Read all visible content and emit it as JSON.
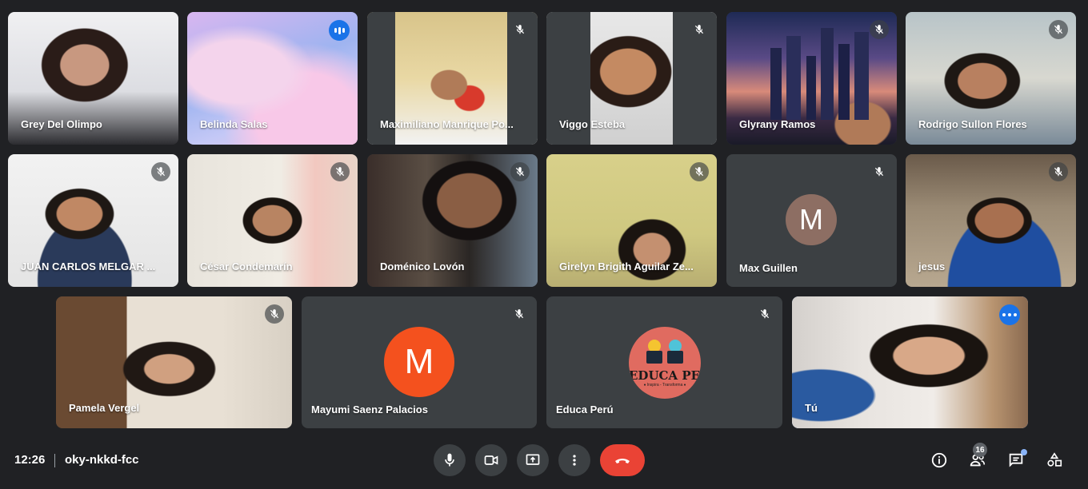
{
  "participants": [
    {
      "name": "Grey Del Olimpo",
      "mic": "none"
    },
    {
      "name": "Belinda Salas",
      "mic": "speaking"
    },
    {
      "name": "Maximiliano Manrique Po...",
      "mic": "muted"
    },
    {
      "name": "Viggo Esteba",
      "mic": "muted"
    },
    {
      "name": "Glyrany Ramos",
      "mic": "muted"
    },
    {
      "name": "Rodrigo Sullon Flores",
      "mic": "muted"
    },
    {
      "name": "JUAN CARLOS MELGAR ...",
      "mic": "muted"
    },
    {
      "name": "César Condemarín",
      "mic": "muted"
    },
    {
      "name": "Doménico Lovón",
      "mic": "muted"
    },
    {
      "name": "Girelyn Brigith Aguilar Ze...",
      "mic": "muted"
    },
    {
      "name": "Max Guillen",
      "mic": "muted",
      "initial": "M",
      "avatar_color": "#8d6e63"
    },
    {
      "name": "jesus",
      "mic": "muted"
    },
    {
      "name": "Pamela Vergel",
      "mic": "muted"
    },
    {
      "name": "Mayumi Saenz Palacios",
      "mic": "muted",
      "initial": "M",
      "avatar_color": "#f4511e"
    },
    {
      "name": "Educa Perú",
      "mic": "muted",
      "logo_text": "EDUCA PERÚ",
      "logo_subtext": "♦ Inspira - Transforma ♦"
    },
    {
      "name": "Tú",
      "mic": "options"
    }
  ],
  "bottom_bar": {
    "time": "12:26",
    "meeting_code": "oky-nkkd-fcc",
    "people_count": "16"
  },
  "colors": {
    "background": "#202124",
    "tile": "#3c4043",
    "accent": "#1a73e8",
    "end_call": "#ea4335"
  },
  "icons": {
    "mic": "mic-icon",
    "camera": "camera-icon",
    "present": "present-screen-icon",
    "more": "more-vertical-icon",
    "end": "end-call-icon",
    "info": "info-icon",
    "people": "people-icon",
    "chat": "chat-icon",
    "activities": "activities-icon"
  }
}
